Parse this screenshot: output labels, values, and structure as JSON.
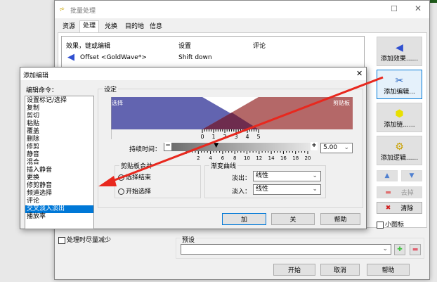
{
  "main": {
    "title": "批量处理",
    "tabs": [
      "资源",
      "处理",
      "兑换",
      "目的地",
      "信息"
    ],
    "active_tab": 1,
    "columns": [
      "效果，链或编辑",
      "设置",
      "评论"
    ],
    "rows": [
      {
        "name": "Offset <GoldWave*>",
        "setting": "Shift down",
        "comment": ""
      }
    ],
    "side_buttons": {
      "add_effect": "添加效果......",
      "add_edit": "添加编辑...",
      "add_chain": "添加链......",
      "add_logic": "添加逻辑......",
      "remove": "去掉",
      "clear": "清除",
      "small_icons": "小图标"
    },
    "reduce_label": "处理时尽量减少",
    "preset_label": "预设",
    "preset_value": "",
    "buttons": {
      "start": "开始",
      "cancel": "取消",
      "help": "帮助"
    }
  },
  "dialog": {
    "title": "添加编辑",
    "commands_label": "编辑命令：",
    "commands": [
      "设置标记/选择",
      "复制",
      "剪切",
      "粘贴",
      "覆盖",
      "删除",
      "修剪",
      "静音",
      "混合",
      "插入静音",
      "更换",
      "修剪静音",
      "频道选择",
      "评论",
      "交叉淡入淡出",
      "播放率"
    ],
    "selected_index": 14,
    "settings_label": "设定",
    "graph_left": "选择",
    "graph_right": "剪贴板",
    "top_ruler": [
      "0",
      "1",
      "2",
      "3",
      "4",
      "5"
    ],
    "duration_label": "持续时间：",
    "duration_value": "5.00",
    "duration_ticks": [
      "2",
      "4",
      "6",
      "8",
      "10",
      "12",
      "14",
      "16",
      "18",
      "20"
    ],
    "duration_fraction": 0.25,
    "paste_group": "剪贴板合并",
    "paste_options": [
      "选择结束",
      "开始选择"
    ],
    "paste_selected": 0,
    "curve_group": "渐变曲线",
    "fade_out_label": "淡出：",
    "fade_out_value": "线性",
    "fade_in_label": "淡入：",
    "fade_in_value": "线性",
    "buttons": {
      "add": "加",
      "close": "关",
      "help": "帮助"
    }
  },
  "colors": {
    "selection": "#0078d7",
    "graph_blue": "#6264b0",
    "graph_red": "#b06060",
    "arrow": "#e8281e"
  }
}
